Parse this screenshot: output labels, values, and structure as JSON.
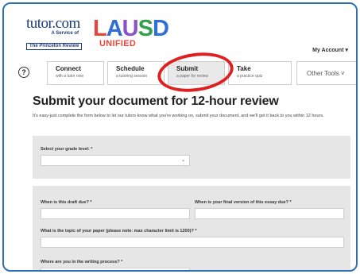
{
  "brand": {
    "tutor_word": "tutor.com",
    "tutor_service": "A Service of",
    "tutor_princeton": "The Princeton Review",
    "district_letters": [
      "L",
      "A",
      "U",
      "S",
      "D"
    ],
    "district_sub": "UNIFIED",
    "colors": {
      "red": "#e8463b",
      "blue": "#2e6fd6",
      "green": "#2fa24c",
      "purple": "#8a52c9",
      "navy": "#1e3d78"
    }
  },
  "header": {
    "account_label": "My Account",
    "account_icon": "caret-down-icon"
  },
  "nav": {
    "help_symbol": "?",
    "items": [
      {
        "title": "Connect",
        "subtitle": "with a tutor now"
      },
      {
        "title": "Schedule",
        "subtitle": "a tutoring session"
      },
      {
        "title": "Submit",
        "subtitle": "a paper for review"
      },
      {
        "title": "Take",
        "subtitle": "a practice quiz"
      }
    ],
    "other_tools": "Other Tools",
    "other_tools_icon": "caret-down-icon"
  },
  "main": {
    "title": "Submit your document for 12-hour review",
    "intro": "It's easy-just complete the form below to let our tutors know what you're working on, submit your document, and we'll get it back to you within 12 hours."
  },
  "form": {
    "grade_label": "Select your grade level: *",
    "draft_due_label": "When is this draft due? *",
    "final_due_label": "When is your final version of this essay due? *",
    "topic_label": "What is the topic of your paper (please note: max character limit is 1200)? *",
    "process_label": "Where are you in the writing process? *"
  }
}
